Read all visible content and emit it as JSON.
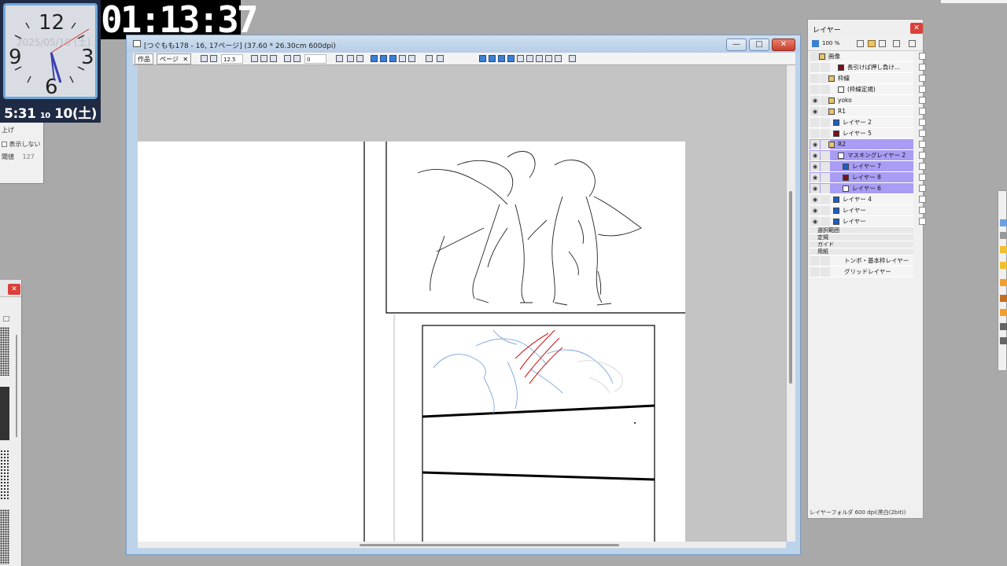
{
  "clock": {
    "date": "2025/05/10 (土)",
    "num_12": "12",
    "num_3": "3",
    "num_6": "6",
    "num_9": "9",
    "digital_time": "5:31",
    "digital_small": "10",
    "digital_day": "10(土)"
  },
  "timer": "01:13:37",
  "left_panel": {
    "line1": "上げ",
    "line2": "表示しない",
    "line3": "閾値",
    "line3_value": "127"
  },
  "main_window": {
    "title": "[つぐもも178 - 16, 17ページ] (37.60 * 26.30cm 600dpi)",
    "tabs": [
      "作品",
      "ページ"
    ],
    "zoom_value": "12.5",
    "rotate_value": "0",
    "btn_minimize": "—",
    "btn_maximize": "□",
    "btn_close": "✕"
  },
  "layers": {
    "title": "レイヤー",
    "opacity": "100 %",
    "status": "レイヤーフォルダ 600 dpi(黒白(2bit))",
    "rows": [
      {
        "name": "画像",
        "kind": "folder-open",
        "selected": false,
        "visible": false
      },
      {
        "name": "長引けば押し負け...",
        "kind": "text",
        "swatch": "#7a1020",
        "selected": false,
        "visible": false
      },
      {
        "name": "枠線",
        "kind": "folder",
        "selected": false,
        "visible": false
      },
      {
        "name": "(枠線定規)",
        "kind": "ruler",
        "selected": false,
        "visible": false
      },
      {
        "name": "yoko",
        "kind": "folder",
        "selected": false,
        "visible": true
      },
      {
        "name": "R1",
        "kind": "folder",
        "selected": false,
        "visible": true
      },
      {
        "name": "レイヤー 2",
        "kind": "layer",
        "swatch": "#1d5fbf",
        "selected": false,
        "visible": false
      },
      {
        "name": "レイヤー 5",
        "kind": "layer",
        "swatch": "#7a1020",
        "selected": false,
        "visible": false
      },
      {
        "name": "R2",
        "kind": "folder",
        "selected": true,
        "visible": true
      },
      {
        "name": "マスキングレイヤー 2",
        "kind": "mask",
        "selected": true,
        "visible": true
      },
      {
        "name": "レイヤー 7",
        "kind": "layer",
        "swatch": "#1d5fbf",
        "selected": true,
        "visible": true
      },
      {
        "name": "レイヤー 8",
        "kind": "layer",
        "swatch": "#7a1020",
        "selected": true,
        "visible": true
      },
      {
        "name": "レイヤー 6",
        "kind": "layer",
        "swatch": "#ffffff",
        "selected": true,
        "visible": true
      },
      {
        "name": "レイヤー 4",
        "kind": "layer",
        "swatch": "#1d5fbf",
        "selected": false,
        "visible": true
      },
      {
        "name": "レイヤー",
        "kind": "layer",
        "swatch": "#1d5fbf",
        "selected": false,
        "visible": true
      },
      {
        "name": "レイヤー",
        "kind": "layer",
        "swatch": "#1d5fbf",
        "selected": false,
        "visible": true
      }
    ],
    "groups": [
      "選択範囲",
      "定規",
      "ガイド",
      "用紙"
    ],
    "paper_rows": [
      "トンボ・基本枠レイヤー",
      "グリッドレイヤー"
    ]
  }
}
